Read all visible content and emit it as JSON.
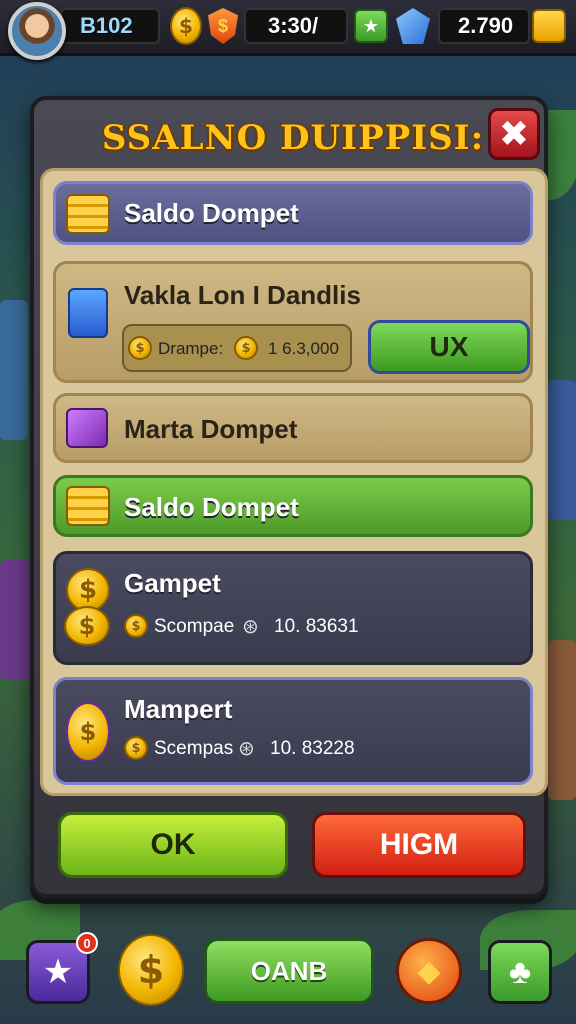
{
  "top_bar": {
    "stat_left": "B102",
    "stat_mid": "3:30/",
    "stat_right": "2.790"
  },
  "dialog": {
    "title": "SSALNO DUIPPISI:",
    "close_glyph": "✖",
    "rows": [
      {
        "label": "Saldo Dompet",
        "style": "purple",
        "icon": "gold-bars-icon"
      },
      {
        "label": "Vakla Lon I Dandlis",
        "style": "tan",
        "icon": "blue-bag-icon",
        "sub_label": "Drampe:",
        "sub_value": "1 6.3,000",
        "action_label": "UX"
      },
      {
        "label": "Marta Dompet",
        "style": "tan",
        "icon": "purple-wallet-icon"
      },
      {
        "label": "Saldo Dompet",
        "style": "green",
        "icon": "gold-bars-icon"
      },
      {
        "label": "Gampet",
        "style": "dark",
        "icon": "coin-stack-icon",
        "detail_label": "Scompae",
        "detail_value": "10. 83631"
      },
      {
        "label": "Mampert",
        "style": "dark",
        "icon": "coin-stack-icon",
        "detail_label": "Scempas",
        "detail_value": "10. 83228"
      }
    ],
    "ok_label": "OK",
    "high_label": "HIGM"
  },
  "bottom_bar": {
    "badge_count": "0",
    "center_label": "OANB"
  },
  "colors": {
    "accent_gold": "#ffc21a",
    "ok_green": "#6bb51a",
    "danger_red": "#d11f12",
    "row_purple": "#5b5e8e"
  }
}
